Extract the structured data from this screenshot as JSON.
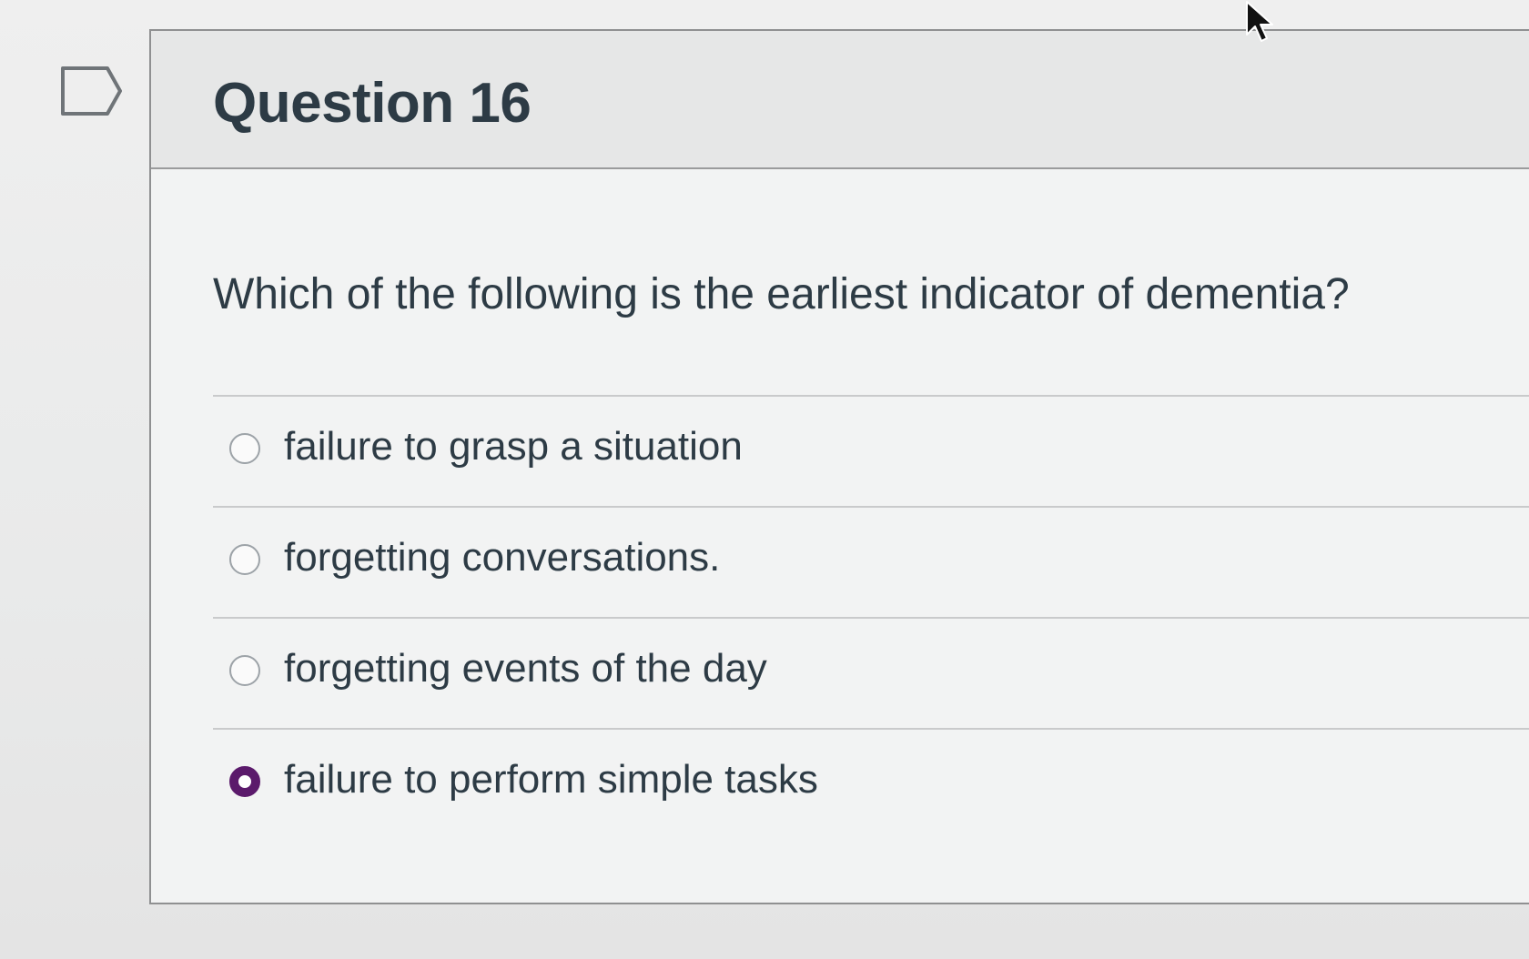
{
  "question": {
    "title": "Question 16",
    "text": "Which of the following is the earliest indicator of dementia?",
    "flag_icon": "flag-question-icon"
  },
  "answers": [
    {
      "label": "failure to grasp a situation",
      "selected": false
    },
    {
      "label": "forgetting conversations.",
      "selected": false
    },
    {
      "label": "forgetting events of the day",
      "selected": false
    },
    {
      "label": "failure to perform simple tasks",
      "selected": true
    }
  ],
  "colors": {
    "text": "#2d3b45",
    "selected_radio": "#5b1a6b",
    "border": "#8f9091"
  }
}
